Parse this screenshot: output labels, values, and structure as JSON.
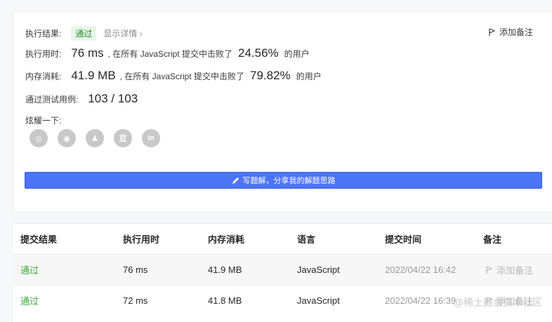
{
  "summary": {
    "result_label": "执行结果:",
    "result_badge": "通过",
    "show_details": "显示详情 ›",
    "add_note": "添加备注",
    "runtime_label": "执行用时:",
    "runtime_value": "76 ms",
    "runtime_mid": ", 在所有 JavaScript 提交中击败了",
    "runtime_pct": "24.56%",
    "runtime_tail": "的用户",
    "memory_label": "内存消耗:",
    "memory_value": "41.9 MB",
    "memory_mid": ", 在所有 JavaScript 提交中击败了",
    "memory_pct": "79.82%",
    "memory_tail": "的用户",
    "tests_label": "通过测试用例:",
    "tests_value": "103 / 103",
    "share_label": "炫耀一下:",
    "share_icons": [
      "wechat-icon",
      "weibo-icon",
      "qq-icon",
      "douban-icon",
      "linkedin-icon"
    ],
    "share_glyphs": [
      "◎",
      "◉",
      "♟",
      "豆",
      "in"
    ],
    "write_solution": "写题解，分享我的解题思路"
  },
  "table": {
    "headers": [
      "提交结果",
      "执行用时",
      "内存消耗",
      "语言",
      "提交时间",
      "备注"
    ],
    "rows": [
      {
        "result": "通过",
        "runtime": "76 ms",
        "memory": "41.9 MB",
        "lang": "JavaScript",
        "time": "2022/04/22 16:42",
        "note": "添加备注"
      },
      {
        "result": "通过",
        "runtime": "72 ms",
        "memory": "41.8 MB",
        "lang": "JavaScript",
        "time": "2022/04/22 16:39",
        "note": "添加备注"
      }
    ]
  },
  "watermark": "@稀土掘金技术社区",
  "colors": {
    "accent": "#4c74f6",
    "pass": "#3aaa3a"
  }
}
